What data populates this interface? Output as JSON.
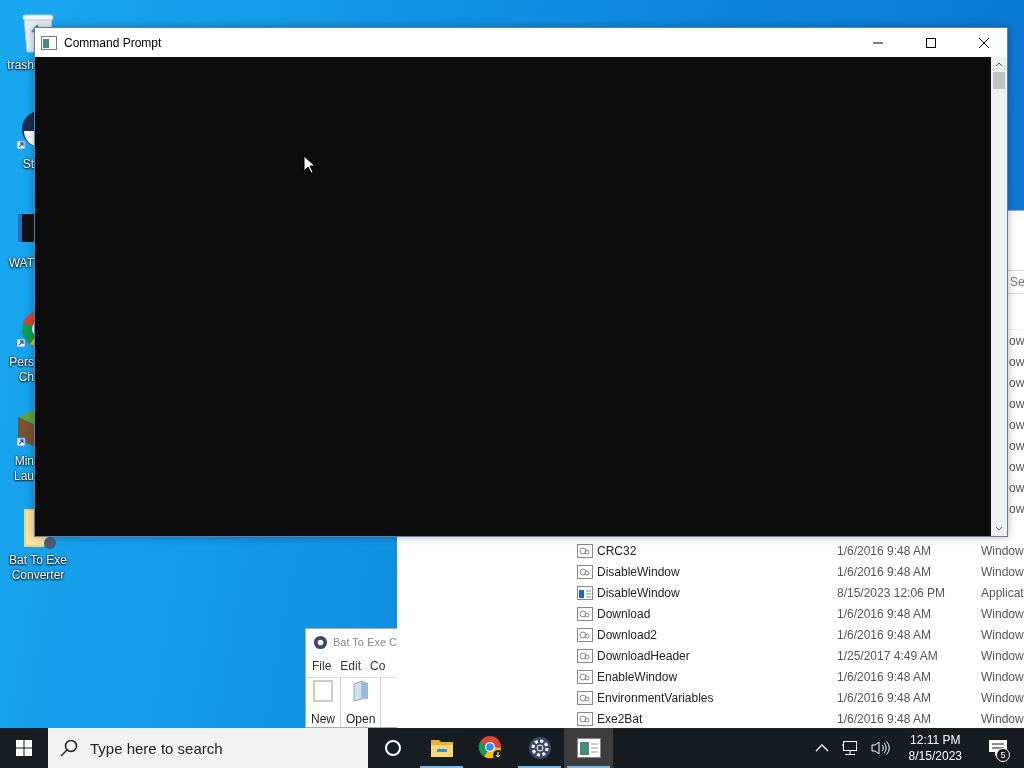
{
  "desktop_icons": [
    {
      "kind": "bin",
      "cut": true,
      "lines": [
        "trash"
      ]
    },
    {
      "kind": "disc",
      "cut": true,
      "lines": [
        "St"
      ]
    },
    {
      "kind": "video",
      "cut": true,
      "lines": [
        "WAT"
      ]
    },
    {
      "kind": "browser",
      "cut": true,
      "lines": [
        "Pers",
        "Ch"
      ]
    },
    {
      "kind": "block",
      "cut": true,
      "lines": [
        "Min",
        "Lau"
      ]
    },
    {
      "kind": "folder",
      "cut": false,
      "lines": [
        "Bat To Exe",
        "Converter"
      ]
    }
  ],
  "bat_window": {
    "title": "Bat To Exe C",
    "menu": [
      "File",
      "Edit",
      "Co"
    ],
    "toolbar": [
      {
        "kind": "new",
        "label": "New"
      },
      {
        "kind": "open",
        "label": "Open"
      }
    ]
  },
  "explorer_window": {
    "search": {
      "placeholder": "Se"
    },
    "type_fragments": [
      "ow",
      "ow",
      "ow",
      "ow",
      "ow",
      "ow",
      "ow",
      "ow",
      "ow"
    ],
    "rows": [
      {
        "kind": "script",
        "name": "CRC32",
        "date": "1/6/2016 9:48 AM",
        "type": "Window",
        "selected": false
      },
      {
        "kind": "script",
        "name": "DisableWindow",
        "date": "1/6/2016 9:48 AM",
        "type": "Window",
        "selected": false
      },
      {
        "kind": "app",
        "name": "DisableWindow",
        "date": "8/15/2023 12:06 PM",
        "type": "Applicat",
        "selected": false
      },
      {
        "kind": "script",
        "name": "Download",
        "date": "1/6/2016 9:48 AM",
        "type": "Window",
        "selected": false
      },
      {
        "kind": "script",
        "name": "Download2",
        "date": "1/6/2016 9:48 AM",
        "type": "Window",
        "selected": false
      },
      {
        "kind": "script",
        "name": "DownloadHeader",
        "date": "1/25/2017 4:49 AM",
        "type": "Window",
        "selected": false
      },
      {
        "kind": "script",
        "name": "EnableWindow",
        "date": "1/6/2016 9:48 AM",
        "type": "Window",
        "selected": false
      },
      {
        "kind": "script",
        "name": "EnvironmentVariables",
        "date": "1/6/2016 9:48 AM",
        "type": "Window",
        "selected": false
      },
      {
        "kind": "script",
        "name": "Exe2Bat",
        "date": "1/6/2016 9:48 AM",
        "type": "Window",
        "selected": false
      }
    ]
  },
  "command_prompt": {
    "title": "Command Prompt"
  },
  "taskbar": {
    "search": {
      "placeholder": "Type here to search"
    },
    "apps": [
      {
        "kind": "cortana",
        "running": false,
        "selected": false
      },
      {
        "kind": "folder",
        "running": true,
        "selected": false
      },
      {
        "kind": "browser",
        "running": false,
        "selected": false
      },
      {
        "kind": "gear",
        "running": true,
        "selected": false
      },
      {
        "kind": "console",
        "running": true,
        "selected": true
      }
    ],
    "clock": {
      "time": "12:11 PM",
      "date": "8/15/2023"
    },
    "notifications": "5"
  }
}
